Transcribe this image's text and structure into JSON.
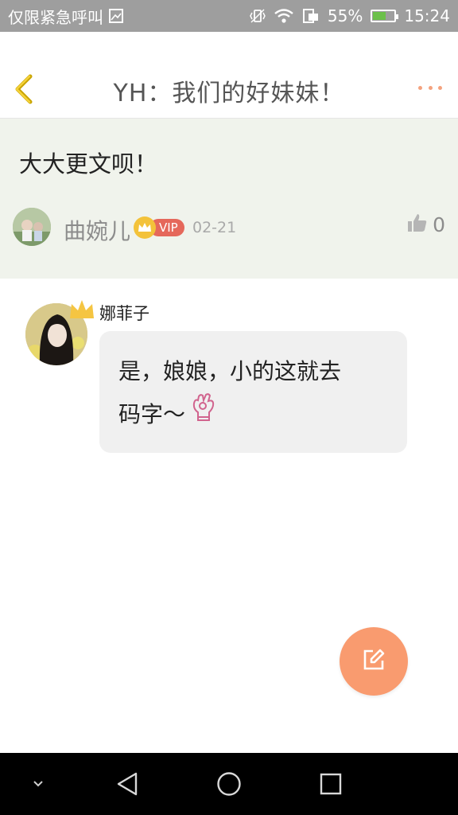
{
  "status_bar": {
    "left_text": "仅限紧急呼叫",
    "battery_percent": "55%",
    "battery_level": 0.55,
    "time": "15:24",
    "icons": [
      "image-icon",
      "vibrate-icon",
      "wifi-icon",
      "sim-icon",
      "battery-charging-icon"
    ]
  },
  "header": {
    "title": "YH：我们的好妹妹！",
    "back_icon": "chevron-left-icon",
    "more_icon": "more-dots-icon",
    "accent_color": "#f4a27e"
  },
  "post": {
    "text": "大大更文呗！",
    "username": "曲婉儿",
    "vip_label": "VIP",
    "date": "02-21",
    "like_count": "0",
    "background_color": "#f0f3ec"
  },
  "reply": {
    "username": "娜菲子",
    "message_line1": "是，娘娘，小的这就去",
    "message_line2": "码字～",
    "emoji_icon": "ok-hand-icon"
  },
  "fab": {
    "icon": "edit-icon",
    "color": "#f99b6f"
  },
  "nav_bar": {
    "icons": [
      "chevron-down-icon",
      "back-triangle-icon",
      "home-circle-icon",
      "recents-square-icon"
    ]
  }
}
